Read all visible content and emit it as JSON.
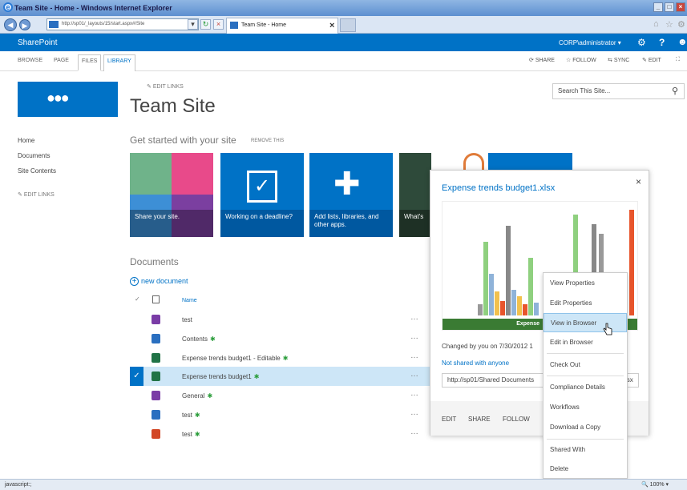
{
  "browser": {
    "window_title": "Team Site - Home - Windows Internet Explorer",
    "address": "http://sp01/_layouts/15/start.aspx#/Site",
    "tab_title": "Team Site - Home",
    "status_text": "javascript:;",
    "zoom": "100%"
  },
  "suitebar": {
    "brand": "SharePoint",
    "user": "CORP\\administrator ▾"
  },
  "ribbon": {
    "tabs": [
      "BROWSE",
      "PAGE",
      "FILES",
      "LIBRARY"
    ],
    "actions": [
      "SHARE",
      "FOLLOW",
      "SYNC",
      "EDIT"
    ]
  },
  "site": {
    "edit_links": "EDIT LINKS",
    "title": "Team Site",
    "search_placeholder": "Search This Site..."
  },
  "quicklaunch": {
    "items": [
      "Home",
      "Documents",
      "Site Contents"
    ],
    "edit_links": "EDIT LINKS"
  },
  "getstarted": {
    "heading": "Get started with your site",
    "remove": "REMOVE THIS",
    "tiles": [
      {
        "caption": "Share your site.",
        "color": "#5a8f6a"
      },
      {
        "caption": "Working on a deadline?",
        "color": "#0072c6"
      },
      {
        "caption": "Add lists, libraries, and other apps.",
        "color": "#0072c6"
      },
      {
        "caption": "What's",
        "color": "#2e4a3a"
      }
    ]
  },
  "documents": {
    "heading": "Documents",
    "new_document": "new document",
    "column_name": "Name",
    "rows": [
      {
        "name": "test",
        "new": "",
        "icon_color": "#7a3ca6"
      },
      {
        "name": "Contents",
        "new": "✱",
        "icon_color": "#2a6fc0"
      },
      {
        "name": "Expense trends budget1 - Editable",
        "new": "✱",
        "icon_color": "#217346"
      },
      {
        "name": "Expense trends budget1",
        "new": "✱",
        "icon_color": "#217346"
      },
      {
        "name": "General",
        "new": "✱",
        "icon_color": "#7a3ca6"
      },
      {
        "name": "test",
        "new": "✱",
        "icon_color": "#2a6fc0"
      },
      {
        "name": "test",
        "new": "✱",
        "icon_color": "#d24726"
      }
    ]
  },
  "callout": {
    "title": "Expense trends budget1.xlsx",
    "preview_banner": "Expense",
    "changed": "Changed by you on 7/30/2012 1",
    "shared": "Not shared with anyone",
    "url": "http://sp01/Shared Documents",
    "url_suffix": "xlsx",
    "footer": [
      "EDIT",
      "SHARE",
      "FOLLOW"
    ]
  },
  "context_menu": {
    "items": [
      "View Properties",
      "Edit Properties",
      "View in Browser",
      "Edit in Browser",
      "Check Out",
      "Compliance Details",
      "Workflows",
      "Download a Copy",
      "Shared With",
      "Delete"
    ],
    "highlighted": "View in Browser"
  },
  "colors": {
    "sharepoint_blue": "#0072c6",
    "selected_row": "#cde6f7",
    "excel_green": "#3a7b33"
  }
}
